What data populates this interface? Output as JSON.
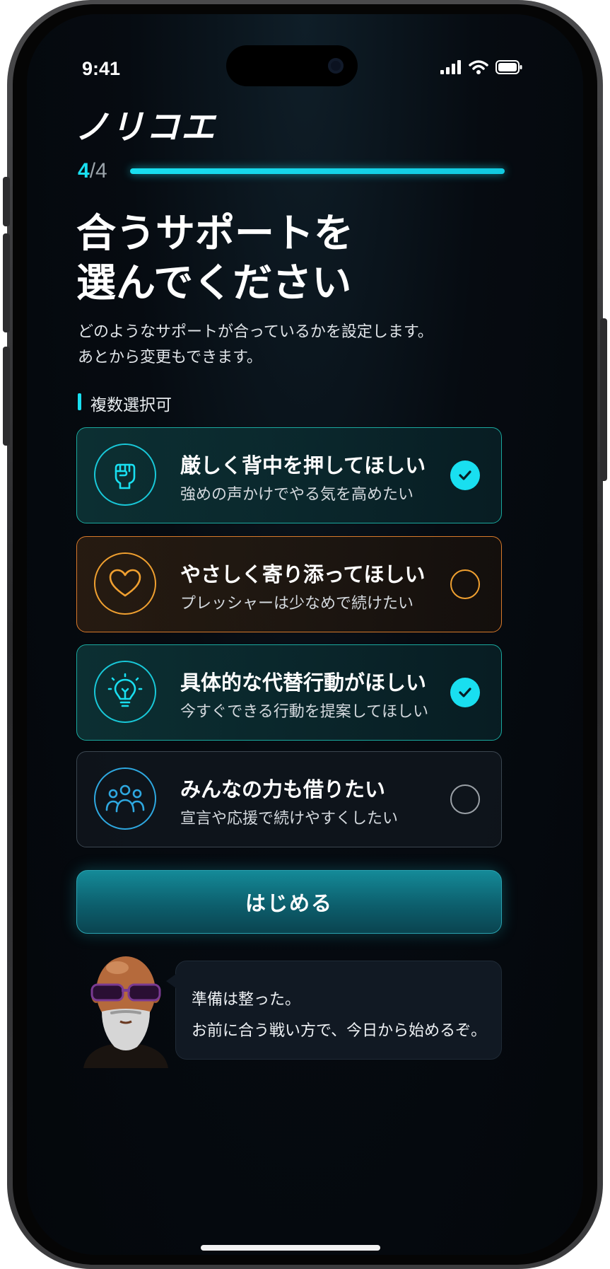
{
  "status_bar": {
    "time": "9:41",
    "icons": [
      "signal-icon",
      "wifi-icon",
      "battery-icon"
    ]
  },
  "app": {
    "logo": "ノリコエ"
  },
  "progress": {
    "current": "4",
    "total": "/4",
    "fraction": 1.0
  },
  "header": {
    "title_line1": "合うサポートを",
    "title_line2": "選んでください",
    "desc_line1": "どのようなサポートが合っているかを設定します。",
    "desc_line2": "あとから変更もできます。"
  },
  "multi_select_label": "複数選択可",
  "options": [
    {
      "title": "厳しく背中を押してほしい",
      "subtitle": "強めの声かけでやる気を高めたい",
      "icon": "fist-icon",
      "selected": true,
      "accent": "#19dff0"
    },
    {
      "title": "やさしく寄り添ってほしい",
      "subtitle": "プレッシャーは少なめで続けたい",
      "icon": "heart-icon",
      "selected": false,
      "accent": "#f0a030"
    },
    {
      "title": "具体的な代替行動がほしい",
      "subtitle": "今すぐできる行動を提案してほしい",
      "icon": "lightbulb-icon",
      "selected": true,
      "accent": "#19dff0"
    },
    {
      "title": "みんなの力も借りたい",
      "subtitle": "宣言や応援で続けやすくしたい",
      "icon": "people-icon",
      "selected": false,
      "accent": "#2ea8e0"
    }
  ],
  "start_button": "はじめる",
  "coach": {
    "avatar": "coach-avatar",
    "line1": "準備は整った。",
    "line2": "お前に合う戦い方で、今日から始めるぞ。"
  },
  "colors": {
    "accent": "#19dff0",
    "warm": "#f0a030",
    "background": "#060b11"
  }
}
